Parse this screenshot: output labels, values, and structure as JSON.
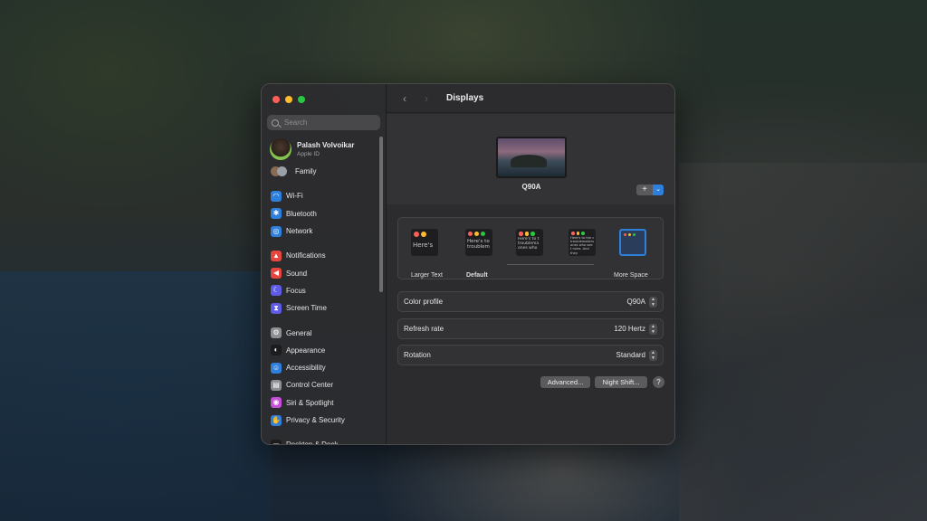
{
  "window": {
    "title": "Displays"
  },
  "sidebar": {
    "search_placeholder": "Search",
    "account": {
      "name": "Palash Volvoikar",
      "subtitle": "Apple ID"
    },
    "family_label": "Family",
    "groups": [
      [
        {
          "label": "Wi-Fi",
          "icon": "wifi-icon",
          "color": "#2f7fdc"
        },
        {
          "label": "Bluetooth",
          "icon": "bluetooth-icon",
          "color": "#2f7fdc"
        },
        {
          "label": "Network",
          "icon": "globe-icon",
          "color": "#2f7fdc"
        }
      ],
      [
        {
          "label": "Notifications",
          "icon": "bell-icon",
          "color": "#e6463d"
        },
        {
          "label": "Sound",
          "icon": "speaker-icon",
          "color": "#e6463d"
        },
        {
          "label": "Focus",
          "icon": "moon-icon",
          "color": "#5e5ce6"
        },
        {
          "label": "Screen Time",
          "icon": "hourglass-icon",
          "color": "#5e5ce6"
        }
      ],
      [
        {
          "label": "General",
          "icon": "gear-icon",
          "color": "#8e8e93"
        },
        {
          "label": "Appearance",
          "icon": "appearance-icon",
          "color": "#1c1c1e"
        },
        {
          "label": "Accessibility",
          "icon": "accessibility-icon",
          "color": "#2f7fdc"
        },
        {
          "label": "Control Center",
          "icon": "control-center-icon",
          "color": "#8e8e93"
        },
        {
          "label": "Siri & Spotlight",
          "icon": "siri-icon",
          "color": "#c64fd8"
        },
        {
          "label": "Privacy & Security",
          "icon": "hand-icon",
          "color": "#2f7fdc"
        }
      ],
      [
        {
          "label": "Desktop & Dock",
          "icon": "dock-icon",
          "color": "#1c1c1e"
        }
      ]
    ]
  },
  "main": {
    "display_name": "Q90A",
    "add_display": {
      "plus": "+",
      "caret": "⌄"
    },
    "resolution_options": [
      {
        "label": "Larger Text",
        "bold": false,
        "thumb_text": "Here's"
      },
      {
        "label": "Default",
        "bold": true,
        "thumb_text": "Here's to troublem"
      },
      {
        "label": "",
        "bold": false,
        "thumb_text": "Here's to t troublema ones who"
      },
      {
        "label": "",
        "bold": false,
        "thumb_text": "Here's to the c troublemakers ones who see t rules. And they"
      },
      {
        "label": "More Space",
        "bold": false,
        "thumb_text": ""
      }
    ],
    "settings": [
      {
        "label": "Color profile",
        "value": "Q90A"
      },
      {
        "label": "Refresh rate",
        "value": "120 Hertz"
      },
      {
        "label": "Rotation",
        "value": "Standard"
      }
    ],
    "buttons": {
      "advanced": "Advanced...",
      "night_shift": "Night Shift...",
      "help": "?"
    }
  }
}
